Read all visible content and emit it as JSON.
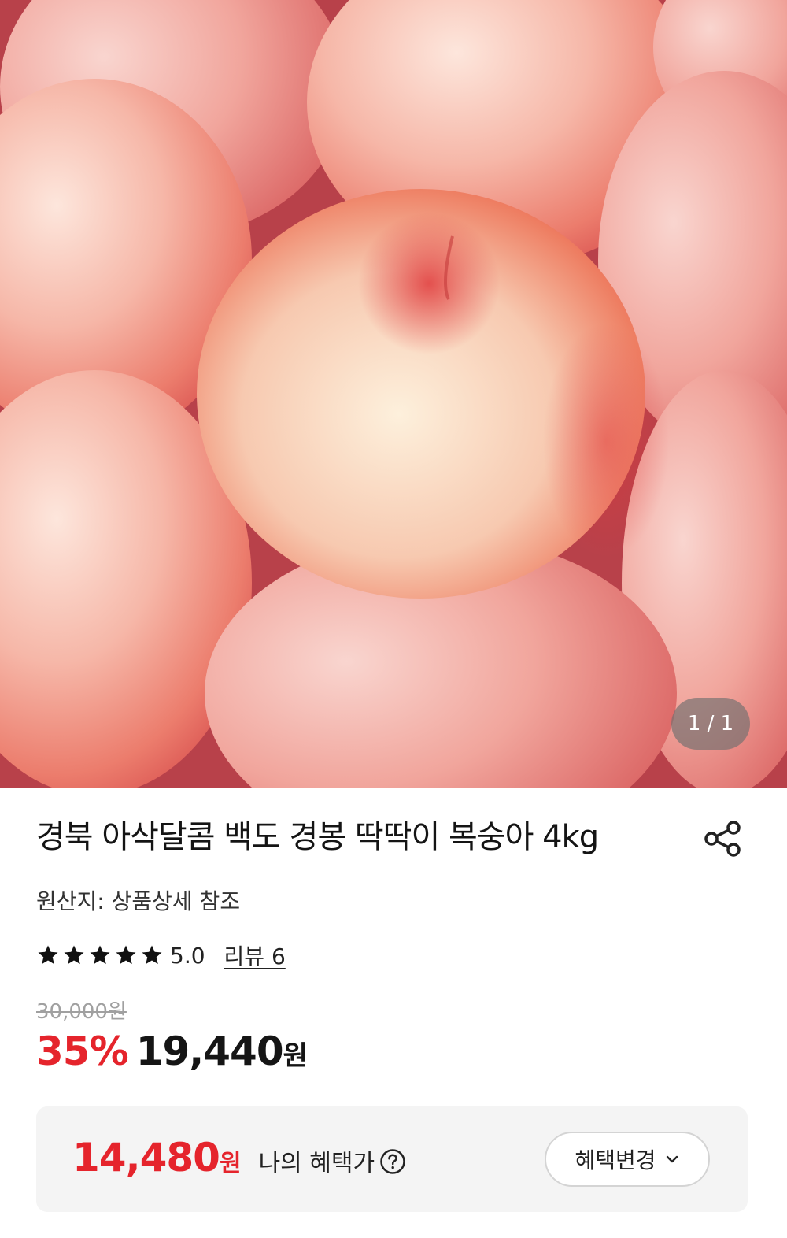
{
  "gallery": {
    "counter": "1 / 1"
  },
  "product": {
    "title": "경북 아삭달콤 백도 경봉 딱딱이 복숭아 4kg",
    "origin": "원산지: 상품상세 참조",
    "rating_stars": 5,
    "rating_value": "5.0",
    "reviews_label": "리뷰 6",
    "original_price": "30,000원",
    "discount": "35%",
    "price": "19,440",
    "price_unit": "원"
  },
  "benefit": {
    "price": "14,480",
    "price_unit": "원",
    "label": "나의 혜택가",
    "change_label": "혜택변경"
  },
  "colors": {
    "accent_red": "#e5242c",
    "benefit_bg": "#f4f4f4"
  },
  "icons": {
    "share": "share-icon",
    "star": "star-icon",
    "help": "question-circle-icon",
    "chevron": "chevron-down-icon"
  }
}
